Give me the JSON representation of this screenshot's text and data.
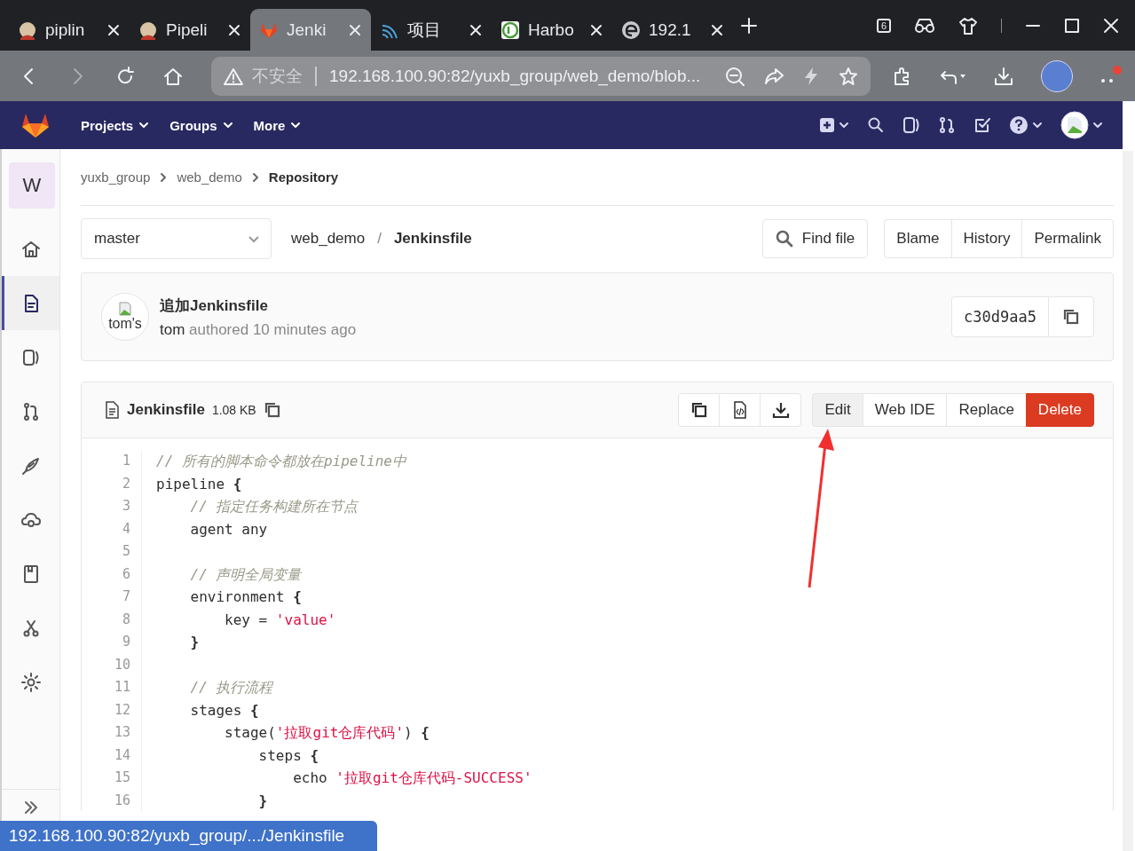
{
  "browser": {
    "tabs": [
      {
        "title": "piplin",
        "selected": false
      },
      {
        "title": "Pipeli",
        "selected": false
      },
      {
        "title": "Jenki",
        "selected": true
      },
      {
        "title": "项目",
        "selected": false
      },
      {
        "title": "Harbo",
        "selected": false
      },
      {
        "title": "192.1",
        "selected": false
      }
    ],
    "tab_count": "6",
    "nav_buttons": [
      {
        "kind": "back",
        "disabled": false
      },
      {
        "kind": "forward",
        "disabled": true
      }
    ],
    "address": {
      "security": "不安全",
      "url": "192.168.100.90:82/yuxb_group/web_demo/blob..."
    }
  },
  "gitlab_nav": {
    "menus": [
      "Projects",
      "Groups",
      "More"
    ]
  },
  "sidebar": {
    "avatar_letter": "W",
    "items": [
      {
        "kind": "home",
        "selected": false
      },
      {
        "kind": "repository",
        "selected": true
      },
      {
        "kind": "issues",
        "selected": false
      },
      {
        "kind": "merge",
        "selected": false
      },
      {
        "kind": "ci",
        "selected": false
      },
      {
        "kind": "operations",
        "selected": false
      },
      {
        "kind": "wiki",
        "selected": false
      },
      {
        "kind": "snippets",
        "selected": false
      },
      {
        "kind": "settings",
        "selected": false
      }
    ]
  },
  "breadcrumbs": [
    "yuxb_group",
    "web_demo",
    "Repository"
  ],
  "file_nav": {
    "branch": "master",
    "path": [
      "web_demo",
      "Jenkinsfile"
    ],
    "path_separator": "/",
    "find_file": "Find file",
    "history_buttons": [
      "Blame",
      "History",
      "Permalink"
    ]
  },
  "commit": {
    "avatar_alt": "tom's",
    "title": "追加Jenkinsfile",
    "author": "tom",
    "meta": "authored 10 minutes ago",
    "sha": "c30d9aa5"
  },
  "file": {
    "name": "Jenkinsfile",
    "size": "1.08 KB",
    "actions": [
      {
        "label": "Edit",
        "kind": "default",
        "hovered": true
      },
      {
        "label": "Web IDE",
        "kind": "default",
        "hovered": false
      },
      {
        "label": "Replace",
        "kind": "default",
        "hovered": false
      },
      {
        "label": "Delete",
        "kind": "danger",
        "hovered": false
      }
    ],
    "lines": [
      {
        "number": "1",
        "tokens": [
          {
            "kind": "comment",
            "text": "// 所有的脚本命令都放在pipeline中"
          }
        ]
      },
      {
        "number": "2",
        "tokens": [
          {
            "kind": "plain",
            "text": "pipeline "
          },
          {
            "kind": "brace",
            "text": "{"
          }
        ]
      },
      {
        "number": "3",
        "tokens": [
          {
            "kind": "comment",
            "text": "    // 指定任务构建所在节点"
          }
        ]
      },
      {
        "number": "4",
        "tokens": [
          {
            "kind": "plain",
            "text": "    agent any"
          }
        ]
      },
      {
        "number": "5"
      },
      {
        "number": "6",
        "tokens": [
          {
            "kind": "comment",
            "text": "    // 声明全局变量"
          }
        ]
      },
      {
        "number": "7",
        "tokens": [
          {
            "kind": "plain",
            "text": "    environment "
          },
          {
            "kind": "brace",
            "text": "{"
          }
        ]
      },
      {
        "number": "8",
        "tokens": [
          {
            "kind": "plain",
            "text": "        key = "
          },
          {
            "kind": "string",
            "text": "'value'"
          }
        ]
      },
      {
        "number": "9",
        "tokens": [
          {
            "kind": "brace",
            "text": "    }"
          }
        ]
      },
      {
        "number": "10"
      },
      {
        "number": "11",
        "tokens": [
          {
            "kind": "comment",
            "text": "    // 执行流程"
          }
        ]
      },
      {
        "number": "12",
        "tokens": [
          {
            "kind": "plain",
            "text": "    stages "
          },
          {
            "kind": "brace",
            "text": "{"
          }
        ]
      },
      {
        "number": "13",
        "tokens": [
          {
            "kind": "plain",
            "text": "        stage("
          },
          {
            "kind": "string",
            "text": "'拉取git仓库代码'"
          },
          {
            "kind": "plain",
            "text": ") "
          },
          {
            "kind": "brace",
            "text": "{"
          }
        ]
      },
      {
        "number": "14",
        "tokens": [
          {
            "kind": "plain",
            "text": "            steps "
          },
          {
            "kind": "brace",
            "text": "{"
          }
        ]
      },
      {
        "number": "15",
        "tokens": [
          {
            "kind": "plain",
            "text": "                echo "
          },
          {
            "kind": "string",
            "text": "'拉取git仓库代码-SUCCESS'"
          }
        ]
      },
      {
        "number": "16",
        "tokens": [
          {
            "kind": "brace",
            "text": "            }"
          }
        ]
      }
    ]
  },
  "status_url": "192.168.100.90:82/yuxb_group/.../Jenkinsfile"
}
